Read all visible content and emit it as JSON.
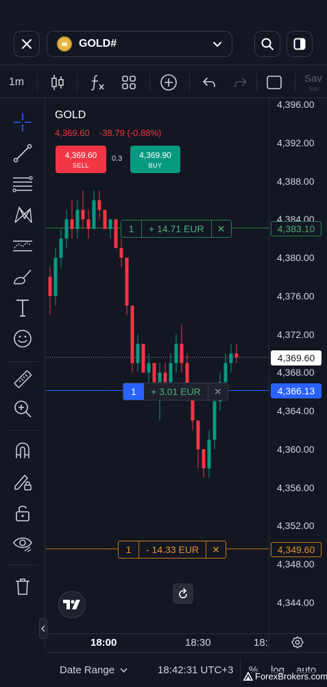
{
  "header": {
    "symbol": "GOLD#",
    "close_icon": "close-icon",
    "search_icon": "search-icon",
    "layout_icon": "layout-icon"
  },
  "toolbar": {
    "interval": "1m",
    "save_label": "Sav",
    "save_sub": "Sav",
    "icons": [
      "candles-icon",
      "indicators-icon",
      "templates-icon",
      "add-icon",
      "undo-icon",
      "redo-icon",
      "fullscreen-icon"
    ]
  },
  "drawing_tools": [
    "crosshair-icon",
    "trendline-icon",
    "fib-icon",
    "pattern-icon",
    "projection-icon",
    "brush-icon",
    "text-icon",
    "emoji-icon",
    "ruler-icon",
    "zoom-in-icon",
    "magnet-icon",
    "lock-draw-icon",
    "unlock-icon",
    "eye-icon",
    "trash-icon"
  ],
  "legend": {
    "title": "GOLD",
    "price": "4,369.60",
    "change": "-38.79 (-0.88%)"
  },
  "trade": {
    "sell_price": "4,369.60",
    "sell_label": "SELL",
    "spread": "0.3",
    "buy_price": "4,369.90",
    "buy_label": "BUY"
  },
  "positions": [
    {
      "qty": "1",
      "pnl": "+ 14.71 EUR",
      "price": "4,383.10",
      "color": "#2e7d4f"
    },
    {
      "qty": "1",
      "pnl": "+ 3.01 EUR",
      "price": "4,366.13",
      "color": "#2962ff"
    },
    {
      "qty": "1",
      "pnl": "- 14.33 EUR",
      "price": "4,349.60",
      "color": "#c77a20"
    }
  ],
  "current_price_tag": "4,369.60",
  "price_axis": [
    "4,396.00",
    "4,392.00",
    "4,388.00",
    "4,384.00",
    "4,380.00",
    "4,376.00",
    "4,372.00",
    "4,368.00",
    "4,364.00",
    "4,360.00",
    "4,356.00",
    "4,352.00",
    "4,348.00",
    "4,344.00"
  ],
  "time_axis": [
    "18:00",
    "18:30",
    "18:"
  ],
  "bottom": {
    "date_range": "Date Range",
    "clock": "18:42:31 UTC+3",
    "percent": "%",
    "log": "log",
    "auto": "auto"
  },
  "watermark": "ForexBrokers.com",
  "chart_data": {
    "type": "candlestick",
    "x_start": "17:58",
    "x_end": "18:36",
    "interval": "1m",
    "ylim": [
      4342,
      4397
    ],
    "ohlc": [
      [
        4378,
        4379,
        4374,
        4376
      ],
      [
        4376,
        4381,
        4375,
        4380
      ],
      [
        4380,
        4383,
        4379,
        4382
      ],
      [
        4382,
        4385,
        4381,
        4384
      ],
      [
        4384,
        4386,
        4382,
        4383
      ],
      [
        4383,
        4386,
        4382,
        4385
      ],
      [
        4385,
        4387,
        4383,
        4384
      ],
      [
        4384,
        4385,
        4382,
        4383
      ],
      [
        4383,
        4387,
        4383,
        4386
      ],
      [
        4386,
        4387,
        4384,
        4385
      ],
      [
        4385,
        4385,
        4383,
        4383
      ],
      [
        4383,
        4384,
        4382,
        4384
      ],
      [
        4384,
        4384,
        4381,
        4381
      ],
      [
        4381,
        4382,
        4379,
        4380
      ],
      [
        4380,
        4380,
        4374,
        4375
      ],
      [
        4375,
        4375,
        4368,
        4369
      ],
      [
        4369,
        4372,
        4368,
        4371
      ],
      [
        4371,
        4371,
        4368,
        4368
      ],
      [
        4368,
        4370,
        4367,
        4369
      ],
      [
        4369,
        4369,
        4366,
        4367
      ],
      [
        4367,
        4369,
        4363,
        4368
      ],
      [
        4368,
        4369,
        4366,
        4367
      ],
      [
        4367,
        4370,
        4366,
        4369
      ],
      [
        4369,
        4372,
        4368,
        4371
      ],
      [
        4371,
        4373,
        4368,
        4369
      ],
      [
        4369,
        4370,
        4365,
        4366
      ],
      [
        4366,
        4366,
        4362,
        4363
      ],
      [
        4363,
        4363,
        4358,
        4360
      ],
      [
        4360,
        4360,
        4357,
        4358
      ],
      [
        4358,
        4362,
        4357,
        4361
      ],
      [
        4361,
        4366,
        4360,
        4365
      ],
      [
        4365,
        4368,
        4364,
        4367
      ],
      [
        4367,
        4370,
        4366,
        4369
      ],
      [
        4369,
        4371,
        4368,
        4370
      ],
      [
        4370,
        4371,
        4369,
        4369.6
      ]
    ]
  }
}
